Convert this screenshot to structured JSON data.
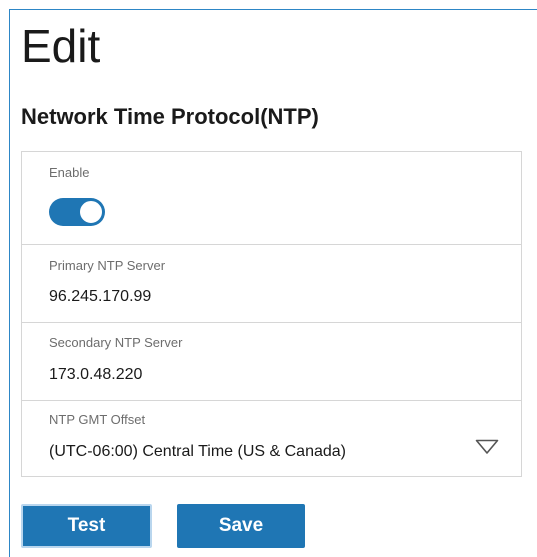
{
  "header": {
    "title": "Edit",
    "section_title": "Network Time Protocol(NTP)"
  },
  "settings": {
    "enable": {
      "label": "Enable",
      "value": true
    },
    "primary_ntp": {
      "label": "Primary NTP Server",
      "value": "96.245.170.99"
    },
    "secondary_ntp": {
      "label": "Secondary NTP Server",
      "value": "173.0.48.220"
    },
    "gmt_offset": {
      "label": "NTP GMT Offset",
      "value": "(UTC-06:00) Central Time (US & Canada)"
    }
  },
  "actions": {
    "test_label": "Test",
    "save_label": "Save"
  },
  "colors": {
    "accent": "#1f76b4",
    "panel_border": "#2d86c6",
    "divider": "#d6d6d6",
    "label_text": "#6d6d6d"
  },
  "icons": {
    "dropdown": "chevron-down-icon"
  }
}
